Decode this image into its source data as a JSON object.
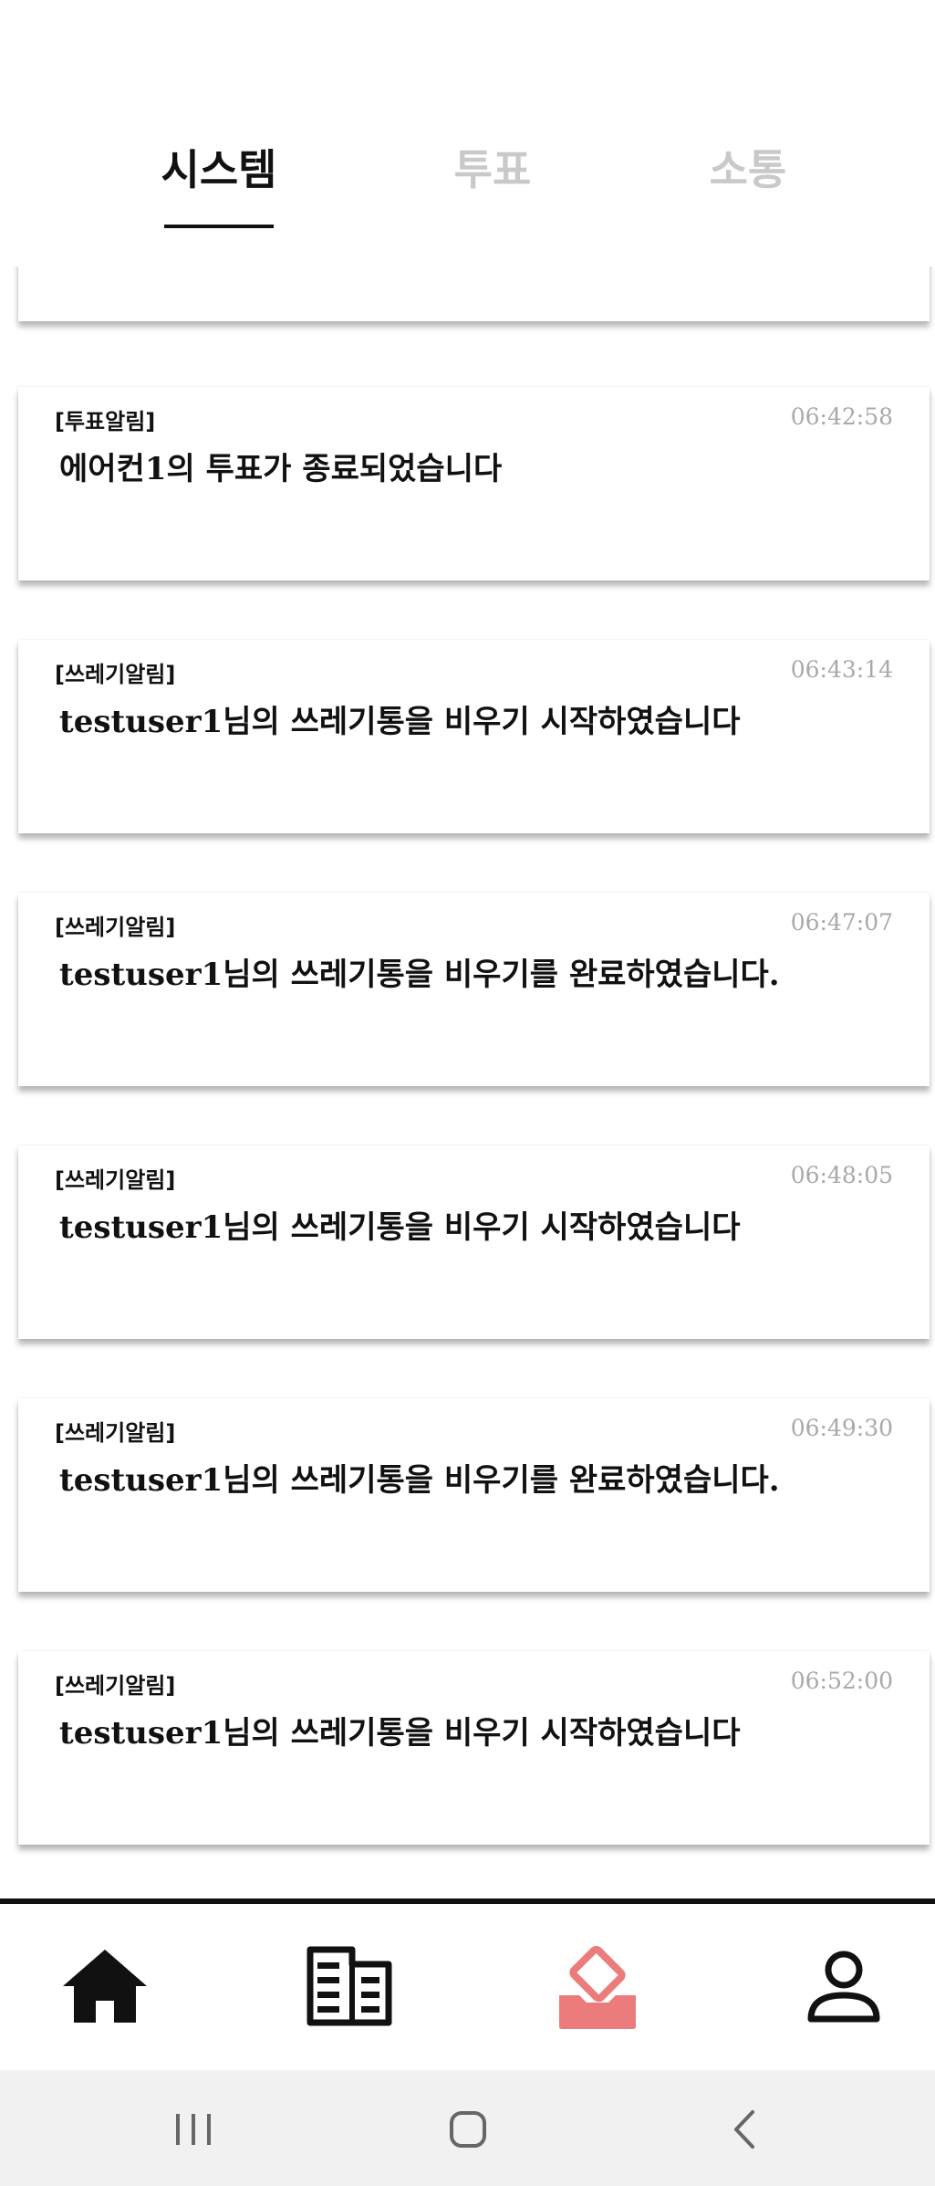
{
  "tabs": {
    "system": "시스템",
    "vote": "투표",
    "talk": "소통"
  },
  "notifications": [
    {
      "category": "[투표알림]",
      "time": "06:42:58",
      "message": "에어컨1의 투표가 종료되었습니다"
    },
    {
      "category": "[쓰레기알림]",
      "time": "06:43:14",
      "message": "testuser1님의 쓰레기통을 비우기 시작하였습니다"
    },
    {
      "category": "[쓰레기알림]",
      "time": "06:47:07",
      "message": "testuser1님의 쓰레기통을 비우기를 완료하였습니다."
    },
    {
      "category": "[쓰레기알림]",
      "time": "06:48:05",
      "message": "testuser1님의 쓰레기통을 비우기 시작하였습니다"
    },
    {
      "category": "[쓰레기알림]",
      "time": "06:49:30",
      "message": "testuser1님의 쓰레기통을 비우기를 완료하였습니다."
    },
    {
      "category": "[쓰레기알림]",
      "time": "06:52:00",
      "message": "testuser1님의 쓰레기통을 비우기 시작하였습니다"
    }
  ],
  "bottom_nav": {
    "items": [
      "home-icon",
      "building-icon",
      "vote-box-icon",
      "profile-icon"
    ],
    "active": "vote-box-icon",
    "active_color": "#ec7b7b",
    "inactive_color": "#111111"
  },
  "system_bar": [
    "recent-apps-icon",
    "home-icon",
    "back-icon"
  ]
}
